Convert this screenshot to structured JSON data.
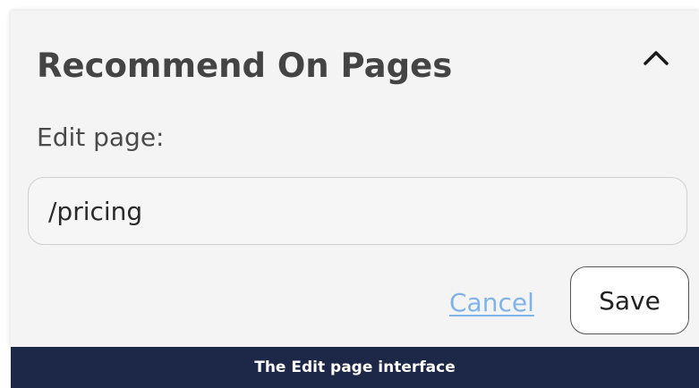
{
  "panel": {
    "title": "Recommend On Pages",
    "collapse_icon": "chevron-up-icon"
  },
  "form": {
    "field_label": "Edit page:",
    "page_value": "/pricing",
    "cancel_label": "Cancel",
    "save_label": "Save"
  },
  "caption": {
    "text": "The Edit page interface"
  },
  "colors": {
    "panel_background": "#f4f4f4",
    "link": "#7fb3ea",
    "caption_bar": "#1d2747"
  }
}
